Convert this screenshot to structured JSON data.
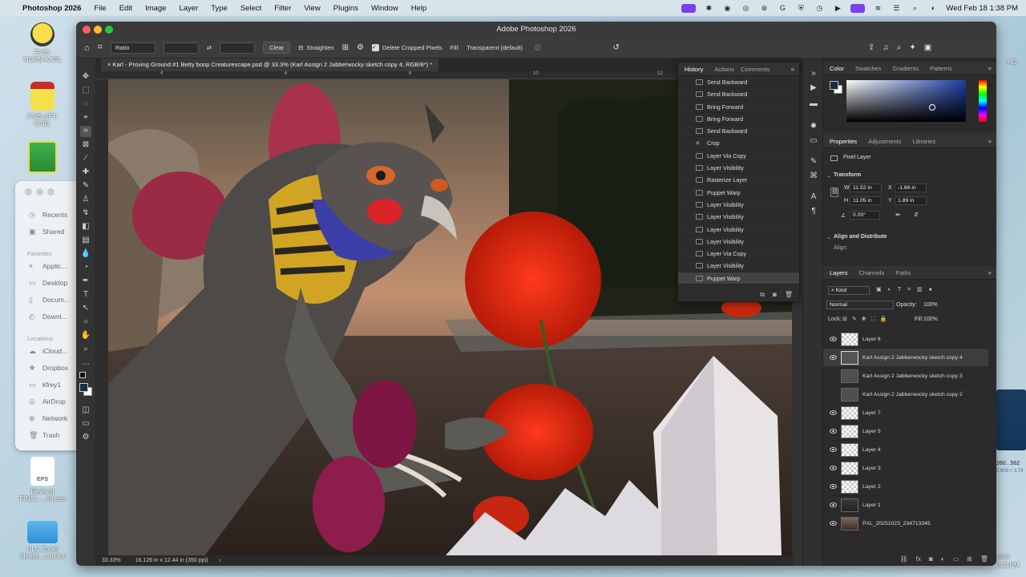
{
  "menubar": {
    "app": "Photoshop 2026",
    "items": [
      "File",
      "Edit",
      "Image",
      "Layer",
      "Type",
      "Select",
      "Filter",
      "View",
      "Plugins",
      "Window",
      "Help"
    ],
    "clock": "Wed Feb 18  1:38 PM"
  },
  "desktop": {
    "icons": [
      {
        "label": "FA25-\nMORN-KARL"
      },
      {
        "label": "FA25-AFT-\nKARL"
      },
      {
        "label": "Revised\nFINAL -...int.eps"
      },
      {
        "label": "NLC Zoom\nMeetin...und Art"
      }
    ],
    "eps_label": "EPS",
    "right_labels": [
      "HD",
      "260...562",
      "2,903 × 3,79",
      "shot",
      "3.31PM"
    ]
  },
  "finder": {
    "items": [
      {
        "icon": "clock-icon",
        "label": "Recents"
      },
      {
        "icon": "shared-icon",
        "label": "Shared"
      }
    ],
    "favorites_header": "Favorites",
    "favorites": [
      {
        "icon": "app-icon",
        "label": "Applic..."
      },
      {
        "icon": "desktop-icon",
        "label": "Desktop"
      },
      {
        "icon": "document-icon",
        "label": "Docum..."
      },
      {
        "icon": "download-icon",
        "label": "Downl..."
      }
    ],
    "locations_header": "Locations",
    "locations": [
      {
        "icon": "cloud-icon",
        "label": "iCloud..."
      },
      {
        "icon": "dropbox-icon",
        "label": "Dropbox"
      },
      {
        "icon": "drive-icon",
        "label": "kfrey1"
      },
      {
        "icon": "airdrop-icon",
        "label": "AirDrop"
      },
      {
        "icon": "network-icon",
        "label": "Network"
      },
      {
        "icon": "trash-icon",
        "label": "Trash"
      }
    ]
  },
  "window": {
    "title": "Adobe Photoshop 2026",
    "doc_tab": "Karl - Proving Ground #1 Betty boop Creaturescape.psd @ 33.3% (Karl Assign 2 Jabberwocky sketch copy 4, RGB/8*) *"
  },
  "options": {
    "ratio": "Ratio",
    "clear": "Clear",
    "straighten": "Straighten",
    "delete_cropped": "Delete Cropped Pixels",
    "fill_label": "Fill:",
    "fill_value": "Transparent (default)"
  },
  "ruler": {
    "marks": [
      "4",
      "6",
      "8",
      "10",
      "12"
    ]
  },
  "status": {
    "zoom": "33.33%",
    "doc_size": "16.126 in x 12.44 in (350 ppi)"
  },
  "history": {
    "tabs": [
      "History",
      "Actions",
      "Comments"
    ],
    "items": [
      "Send Backward",
      "Send Backward",
      "Bring Forward",
      "Bring Forward",
      "Send Backward",
      "Crop",
      "Layer Via Copy",
      "Layer Visibility",
      "Rasterize Layer",
      "Puppet Warp",
      "Layer Visibility",
      "Layer Visibility",
      "Layer Visibility",
      "Layer Visibility",
      "Layer Via Copy",
      "Layer Visibility",
      "Puppet Warp"
    ]
  },
  "color": {
    "tabs": [
      "Color",
      "Swatches",
      "Gradients",
      "Patterns"
    ],
    "foreground": "#1c2b44",
    "background": "#ffffff"
  },
  "properties": {
    "tabs": [
      "Properties",
      "Adjustments",
      "Libraries"
    ],
    "kind": "Pixel Layer",
    "transform_header": "Transform",
    "w_label": "W",
    "w": "11.52 in",
    "x_label": "X",
    "x": "-1.66 in",
    "h_label": "H",
    "h": "11.05 in",
    "y_label": "Y",
    "y": "1.89 in",
    "angle": "0.00°",
    "align_header": "Align and Distribute",
    "align_label": "Align:"
  },
  "layers": {
    "tabs": [
      "Layers",
      "Channels",
      "Paths"
    ],
    "filter": "Kind",
    "blend": "Normal",
    "opacity_label": "Opacity:",
    "opacity": "100%",
    "lock_label": "Lock:",
    "fill_label": "Fill:",
    "fill": "100%",
    "items": [
      {
        "name": "Layer 6",
        "visible": true
      },
      {
        "name": "Karl Assign 2 Jabberwocky sketch copy 4",
        "visible": true
      },
      {
        "name": "Karl Assign 2 Jabberwocky sketch copy 3",
        "visible": false
      },
      {
        "name": "Karl Assign 2 Jabberwocky sketch copy 2",
        "visible": false
      },
      {
        "name": "Layer 7",
        "visible": true
      },
      {
        "name": "Layer 5",
        "visible": true
      },
      {
        "name": "Layer 4",
        "visible": true
      },
      {
        "name": "Layer 3",
        "visible": true
      },
      {
        "name": "Layer 2",
        "visible": true
      },
      {
        "name": "Layer 1",
        "visible": true
      },
      {
        "name": "PXL_20251023_234713345",
        "visible": true
      }
    ]
  }
}
